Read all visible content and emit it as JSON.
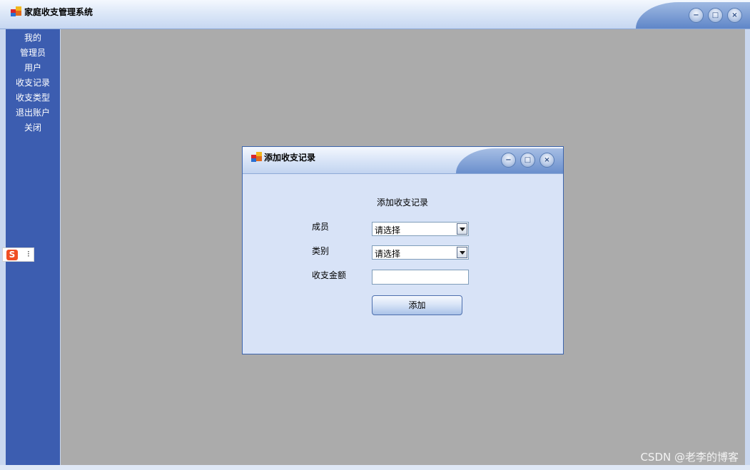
{
  "main_window": {
    "title": "家庭收支管理系统",
    "controls": {
      "minimize": "−",
      "maximize": "□",
      "close": "×"
    }
  },
  "sidebar": {
    "items": [
      {
        "label": "我的"
      },
      {
        "label": "管理员"
      },
      {
        "label": "用户"
      },
      {
        "label": "收支记录"
      },
      {
        "label": "收支类型"
      },
      {
        "label": "退出账户"
      },
      {
        "label": "关闭"
      }
    ]
  },
  "ime": {
    "logo": "S",
    "handle": "⁝"
  },
  "dialog": {
    "title": "添加收支记录",
    "controls": {
      "minimize": "−",
      "maximize": "□",
      "close": "×"
    },
    "heading": "添加收支记录",
    "member_label": "成员",
    "member_value": "请选择",
    "category_label": "类别",
    "category_value": "请选择",
    "amount_label": "收支金额",
    "amount_value": "",
    "add_button": "添加"
  },
  "watermark": "CSDN @老李的博客",
  "colors": {
    "sidebar": "#3c5db0",
    "content": "#ababab",
    "dialog_body": "#d8e3f7",
    "titlebar_light": "#f4f8fe",
    "titlebar_accent": "#5f86c8"
  }
}
